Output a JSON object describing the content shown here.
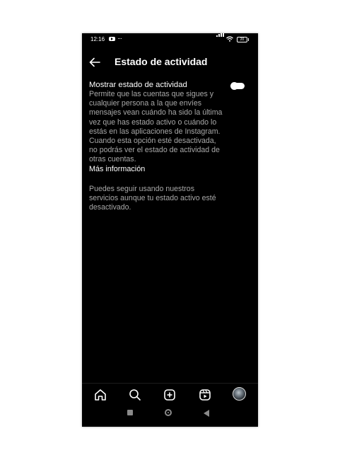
{
  "status_bar": {
    "time": "12:16",
    "overflow": "···",
    "battery": "20",
    "icons": [
      "youtube-icon",
      "signal-icon",
      "wifi-icon",
      "battery-icon"
    ]
  },
  "header": {
    "title": "Estado de actividad",
    "back_icon": "arrow-left-icon"
  },
  "setting": {
    "label": "Mostrar estado de actividad",
    "description": "Permite que las cuentas que sigues y cualquier persona a la que envíes mensajes vean cuándo ha sido la última vez que has estado activo o cuándo lo estás en las aplicaciones de Instagram. Cuando esta opción esté desactivada, no podrás ver el estado de actividad de otras cuentas.",
    "more_link": "Más información",
    "toggle_on": false
  },
  "note": "Puedes seguir usando nuestros servicios aunque tu estado activo esté desactivado.",
  "bottom_nav": {
    "items": [
      "home-icon",
      "search-icon",
      "create-post-icon",
      "reels-icon",
      "profile-avatar"
    ]
  },
  "system_nav": {
    "items": [
      "recent-apps-button",
      "home-button",
      "back-button"
    ]
  },
  "colors": {
    "background": "#000000",
    "primary_text": "#ffffff",
    "secondary_text": "#a8a8a8"
  }
}
